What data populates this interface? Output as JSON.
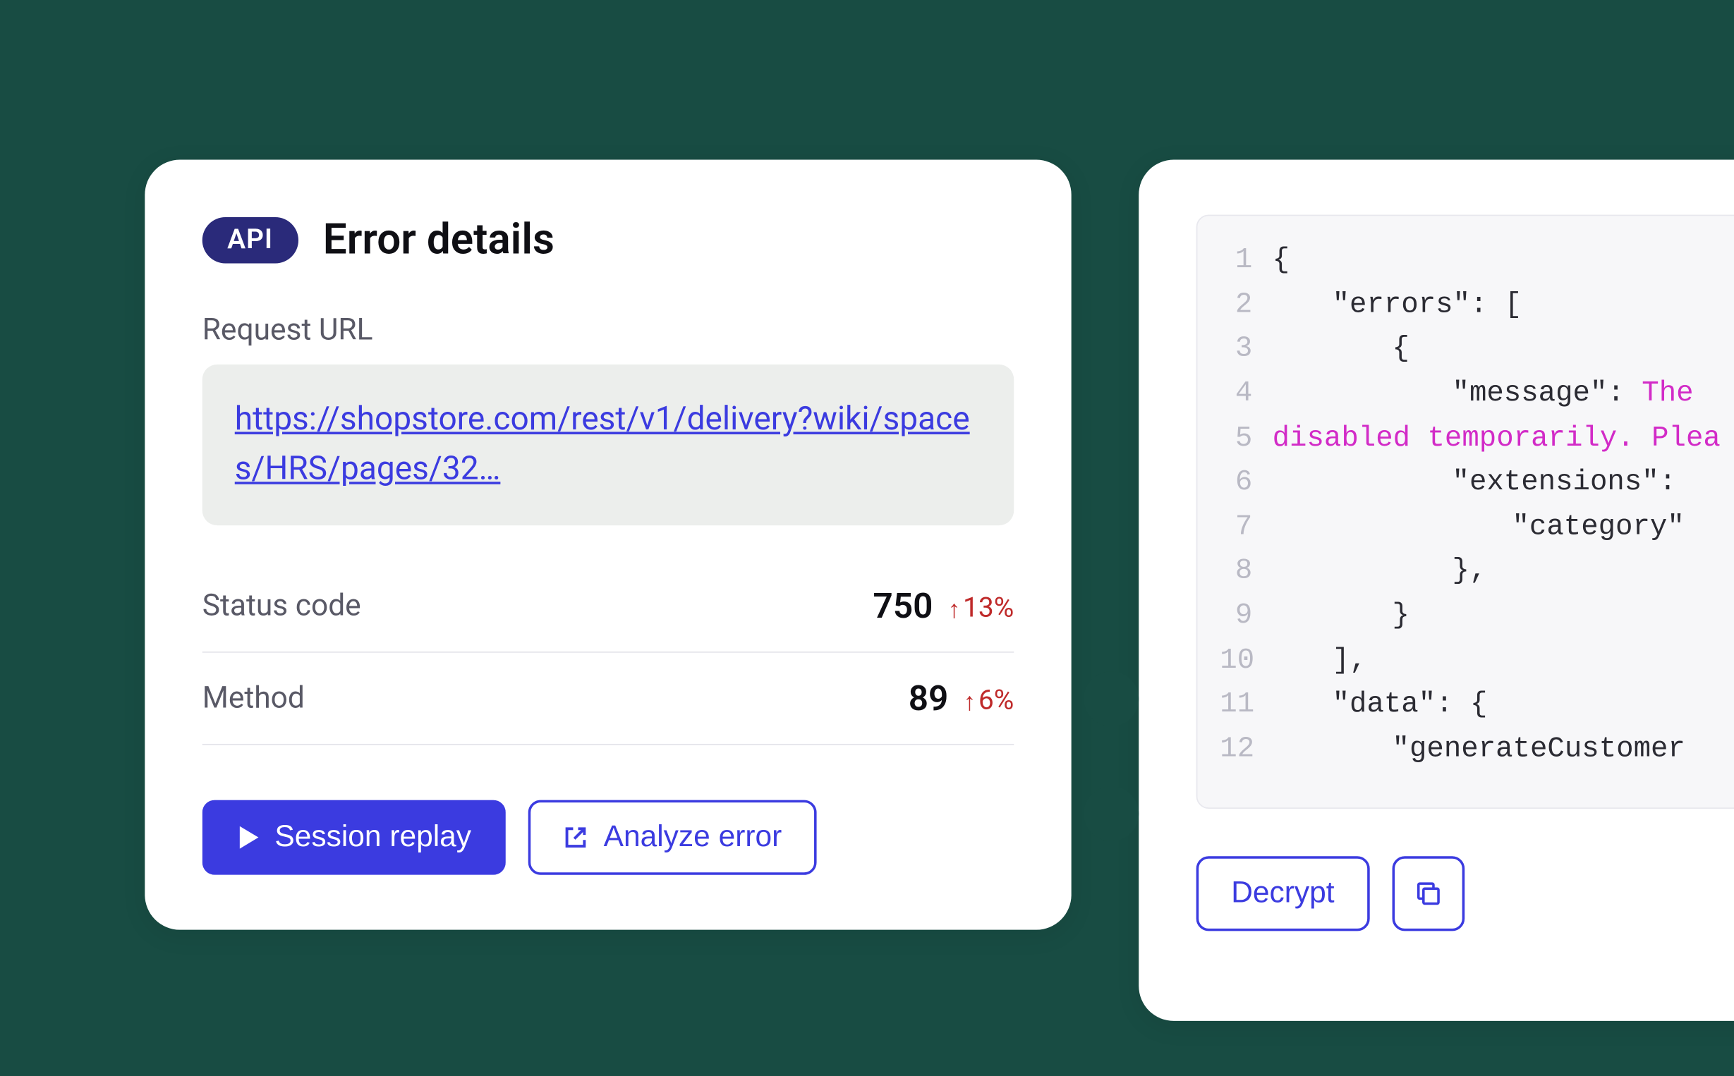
{
  "left": {
    "badge": "API",
    "title": "Error details",
    "url_label": "Request URL",
    "url": "https://shopstore.com/rest/v1/delivery?wiki/spaces/HRS/pages/32…",
    "metrics": [
      {
        "label": "Status code",
        "value": "750",
        "delta": "13%"
      },
      {
        "label": "Method",
        "value": "89",
        "delta": "6%"
      }
    ],
    "actions": {
      "session_replay": "Session replay",
      "analyze_error": "Analyze error"
    }
  },
  "right": {
    "code": {
      "l1": "{",
      "l2a": "\"errors\"",
      "l2b": ": [",
      "l3": "{",
      "l4a": "\"message\"",
      "l4b": ": ",
      "l4c": "The",
      "l5a": "disabled temporarily.",
      "l5b": " Plea",
      "l6a": "\"extensions\"",
      "l6b": ":",
      "l7a": "\"category\"",
      "l8": "},",
      "l9": "}",
      "l10": "],",
      "l11a": "\"data\"",
      "l11b": ": {",
      "l12a": "\"generateCustomer"
    },
    "actions": {
      "decrypt": "Decrypt"
    }
  }
}
